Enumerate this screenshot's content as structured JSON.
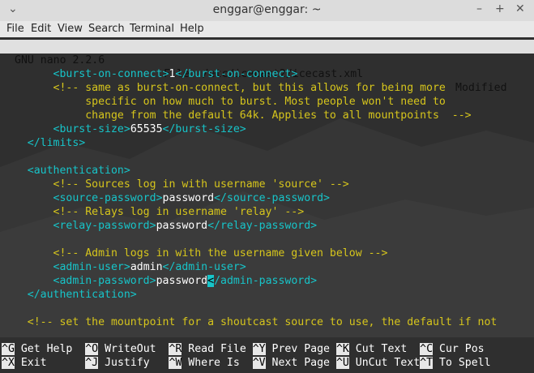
{
  "window": {
    "title": "enggar@enggar: ~",
    "ctrl_left": "⌄",
    "ctrl_min": "–",
    "ctrl_max": "+",
    "ctrl_close": "✕"
  },
  "menu": [
    "File",
    "Edit",
    "View",
    "Search",
    "Terminal",
    "Help"
  ],
  "nano": {
    "version": "GNU nano 2.2.6",
    "file": "File: /etc/icecast2/icecast.xml",
    "state": "Modified"
  },
  "lines": [
    {
      "indent": "        ",
      "tag1": "<burst-on-connect>",
      "val": "1",
      "tag2": "</burst-on-connect>"
    },
    {
      "indent": "        ",
      "comment": "<!-- same as burst-on-connect, but this allows for being more"
    },
    {
      "indent": "             ",
      "comment": "specific on how much to burst. Most people won't need to"
    },
    {
      "indent": "             ",
      "comment": "change from the default 64k. Applies to all mountpoints  -->"
    },
    {
      "indent": "        ",
      "tag1": "<burst-size>",
      "val": "65535",
      "tag2": "</burst-size>"
    },
    {
      "indent": "    ",
      "tag1": "</limits>"
    },
    {
      "indent": ""
    },
    {
      "indent": "    ",
      "tag1": "<authentication>"
    },
    {
      "indent": "        ",
      "comment": "<!-- Sources log in with username 'source' -->"
    },
    {
      "indent": "        ",
      "tag1": "<source-password>",
      "val": "password",
      "tag2": "</source-password>"
    },
    {
      "indent": "        ",
      "comment": "<!-- Relays log in username 'relay' -->"
    },
    {
      "indent": "        ",
      "tag1": "<relay-password>",
      "val": "password",
      "tag2": "</relay-password>"
    },
    {
      "indent": ""
    },
    {
      "indent": "        ",
      "comment": "<!-- Admin logs in with the username given below -->"
    },
    {
      "indent": "        ",
      "tag1": "<admin-user>",
      "val": "admin",
      "tag2": "</admin-user>"
    },
    {
      "indent": "        ",
      "tag1": "<admin-password>",
      "val": "password",
      "cursor": "<",
      "tag2": "/admin-password>"
    },
    {
      "indent": "    ",
      "tag1": "</authentication>"
    },
    {
      "indent": ""
    },
    {
      "indent": "    ",
      "comment": "<!-- set the mountpoint for a shoutcast source to use, the default if not"
    }
  ],
  "shortcuts_row1": [
    {
      "key": "^G",
      "label": " Get Help  "
    },
    {
      "key": "^O",
      "label": " WriteOut  "
    },
    {
      "key": "^R",
      "label": " Read File "
    },
    {
      "key": "^Y",
      "label": " Prev Page "
    },
    {
      "key": "^K",
      "label": " Cut Text  "
    },
    {
      "key": "^C",
      "label": " Cur Pos"
    }
  ],
  "shortcuts_row2": [
    {
      "key": "^X",
      "label": " Exit      "
    },
    {
      "key": "^J",
      "label": " Justify   "
    },
    {
      "key": "^W",
      "label": " Where Is  "
    },
    {
      "key": "^V",
      "label": " Next Page "
    },
    {
      "key": "^U",
      "label": " UnCut Text"
    },
    {
      "key": "^T",
      "label": " To Spell"
    }
  ]
}
